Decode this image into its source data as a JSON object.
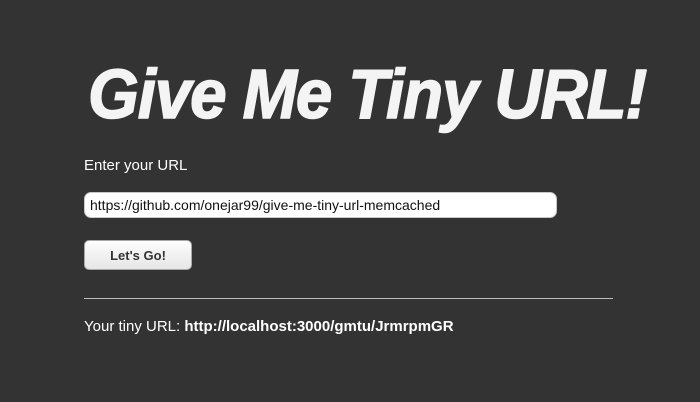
{
  "header": {
    "title": "Give Me Tiny URL!"
  },
  "form": {
    "url_label": "Enter your URL",
    "url_value": "https://github.com/onejar99/give-me-tiny-url-memcached",
    "submit_label": "Let's Go!"
  },
  "result": {
    "label": "Your tiny URL:",
    "tiny_url": "http://localhost:3000/gmtu/JrmrpmGR"
  }
}
